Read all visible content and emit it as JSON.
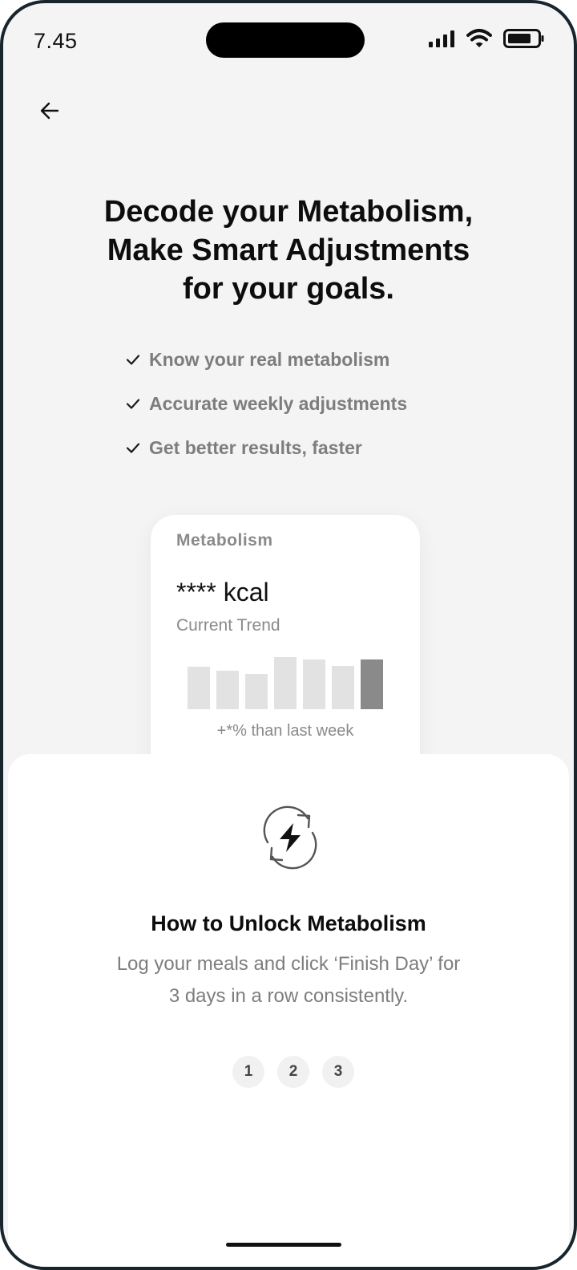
{
  "status_bar": {
    "time": "7.45"
  },
  "header": {
    "back_icon": "arrow-left-icon"
  },
  "headline": {
    "line1": "Decode your Metabolism,",
    "line2": "Make Smart Adjustments",
    "line3": "for your goals."
  },
  "features": [
    {
      "icon": "check-icon",
      "label": "Know your real metabolism"
    },
    {
      "icon": "check-icon",
      "label": "Accurate weekly adjustments"
    },
    {
      "icon": "check-icon",
      "label": "Get better results, faster"
    }
  ],
  "metabolism_card": {
    "title": "Metabolism",
    "value": "**** kcal",
    "subtitle": "Current Trend",
    "trend_note": "+*% than last week",
    "chart_data": {
      "type": "bar",
      "categories": [
        "",
        "",
        "",
        "",
        "",
        "",
        ""
      ],
      "values": [
        0.8,
        0.73,
        0.67,
        0.98,
        0.94,
        0.82,
        0.94
      ],
      "highlight_index": 6,
      "colors": {
        "bar": "#e2e2e2",
        "highlight": "#8a8a8a"
      }
    }
  },
  "unlock_sheet": {
    "icon": "sync-lightning-icon",
    "title": "How to Unlock Metabolism",
    "description_line1": "Log your meals and click ‘Finish Day’ for",
    "description_line2": "3 days in a row consistently.",
    "steps": [
      "1",
      "2",
      "3"
    ]
  },
  "colors": {
    "background": "#f4f4f4",
    "sheet": "#ffffff",
    "muted_text": "#7d7d7d",
    "frame": "#17252c"
  }
}
